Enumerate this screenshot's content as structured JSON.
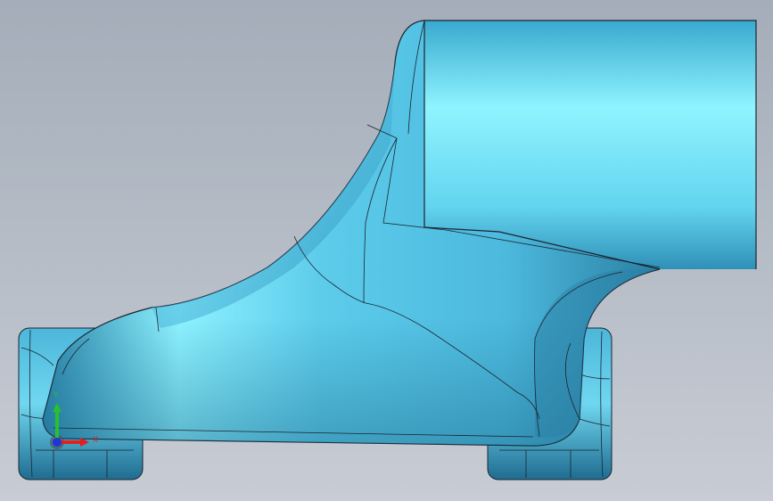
{
  "viewport": {
    "background_top": "#a4adb9",
    "background_bottom": "#c8ccd4"
  },
  "model": {
    "surface_color": "#5ccbe8",
    "highlight_color": "#8ff4ff",
    "shadow_color": "#2a7e9e",
    "edge_color": "#1c2430"
  },
  "triad": {
    "y_label": "Y",
    "x_label": "X",
    "y_color": "#26c22e",
    "x_color": "#e0201e",
    "z_color": "#1c36d8"
  }
}
